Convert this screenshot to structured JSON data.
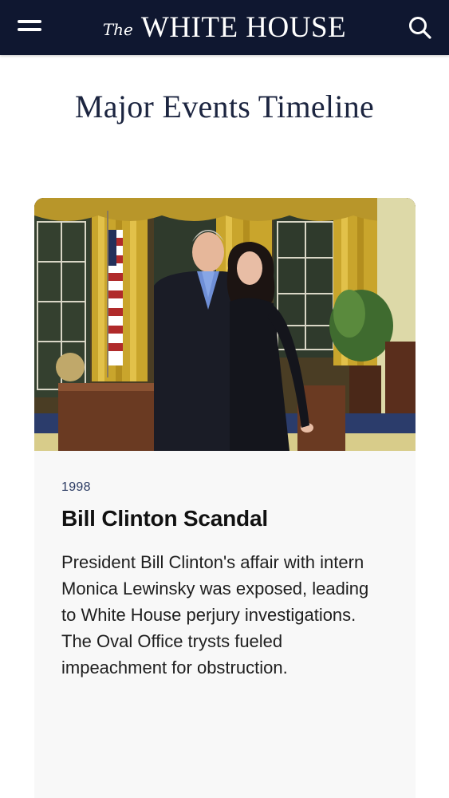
{
  "header": {
    "brand_prefix": "The",
    "brand_name": "WHITE HOUSE",
    "menu_icon": "hamburger-menu-icon",
    "search_icon": "search-icon",
    "background_color": "#0f1730"
  },
  "page": {
    "title": "Major Events Timeline"
  },
  "event": {
    "year": "1998",
    "title": "Bill Clinton Scandal",
    "description": "President Bill Clinton's affair with intern Monica Lewinsky was exposed, leading to White House perjury investigations. The Oval Office trysts fueled impeachment for obstruction."
  }
}
